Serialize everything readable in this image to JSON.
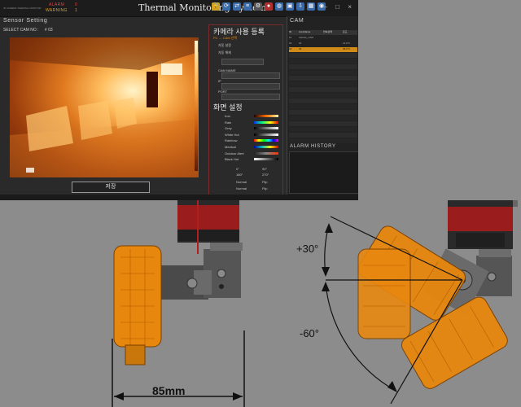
{
  "app": {
    "brand": "IR CAMERA THERMAL MONITOR",
    "alarm_label": "ALARM",
    "alarm_value": "0",
    "warning_label": "WARNING",
    "warning_value": "1",
    "title": "Thermal Monitoring System",
    "window_controls": "– □ ×",
    "accent_color": "#e08a20"
  },
  "sensor": {
    "heading": "Sensor Setting",
    "select_cam": "SELECT CAM NO :",
    "cam_no": "# 03",
    "save": "저장"
  },
  "form": {
    "title": "카메라 사용 등록",
    "subtitle": "PC ↔ CAM 선택",
    "auto_label": "자동 설정",
    "manual_label": "자동 해제",
    "cam_name": "CAM NAME",
    "ip": "IP",
    "port": "PORT",
    "screen_title": "화면 설정",
    "palettes": [
      "Iron",
      "Rain",
      "Grey",
      "White Hot",
      "Rainbow",
      "Medical",
      "Outdoor Alert",
      "Black Hot"
    ],
    "angle_0": "0°",
    "angle_90": "90°",
    "angle_180": "180°",
    "angle_270": "270°",
    "normal": "Normal",
    "flip": "Flip"
  },
  "cam_table": {
    "heading": "CAM",
    "headers": [
      "ID",
      "CamName",
      "연속상태",
      "온도"
    ],
    "rows": [
      [
        "01",
        "Vehicle_CAM",
        "",
        ""
      ],
      [
        "02",
        "02",
        "",
        "14.9°C"
      ],
      [
        "03",
        "03",
        "",
        "38.0°C"
      ]
    ],
    "alarm_history": "ALARM HISTORY"
  },
  "drawing": {
    "width_dim": "85mm",
    "angle_up": "+30°",
    "angle_down": "-60°"
  }
}
